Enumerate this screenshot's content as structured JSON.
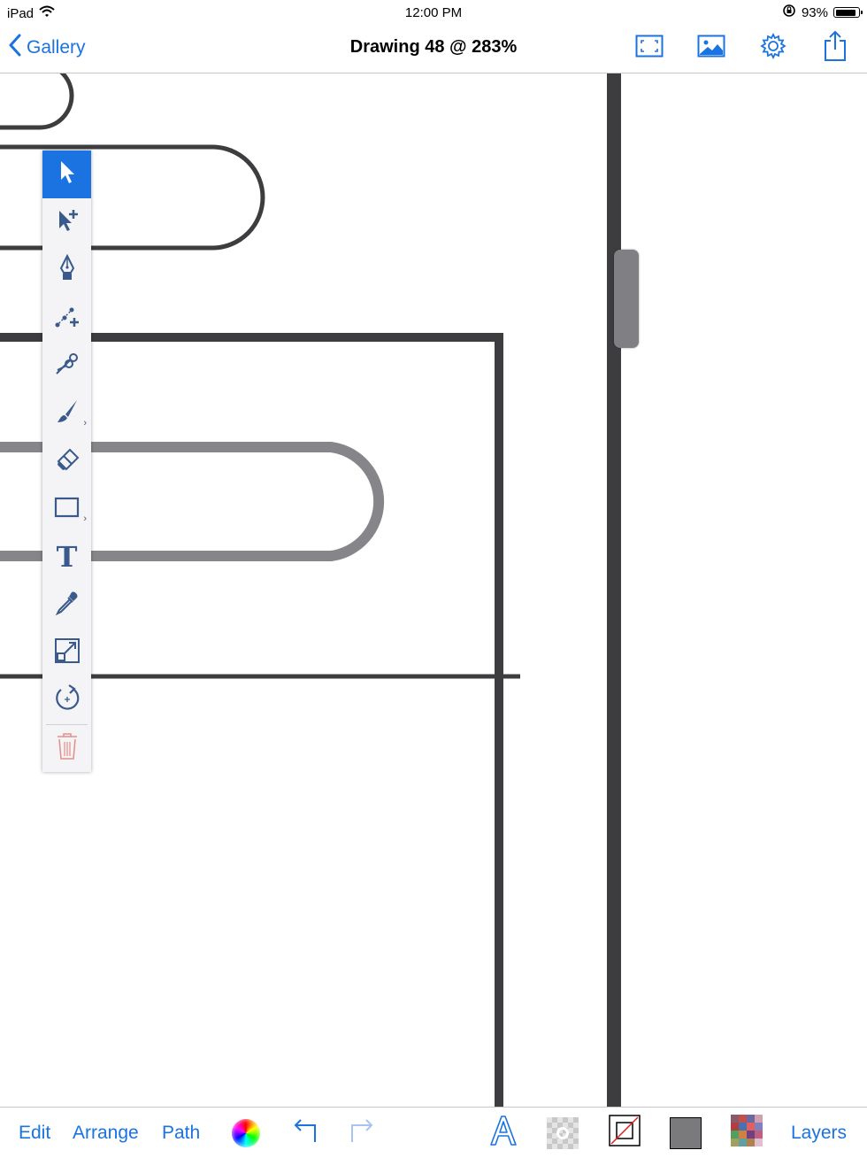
{
  "status_bar": {
    "device": "iPad",
    "time": "12:00 PM",
    "battery": "93%",
    "battery_level": 0.93
  },
  "nav": {
    "back_label": "Gallery",
    "title": "Drawing 48 @ 283%",
    "actions": [
      "fit-screen-icon",
      "image-icon",
      "gear-icon",
      "share-icon"
    ]
  },
  "tools": [
    {
      "name": "select",
      "icon": "arrow-cursor-icon",
      "active": true
    },
    {
      "name": "node-select",
      "icon": "arrow-plus-icon"
    },
    {
      "name": "pen",
      "icon": "pen-nib-icon"
    },
    {
      "name": "add-anchor",
      "icon": "anchor-plus-icon"
    },
    {
      "name": "scissors",
      "icon": "scissors-icon"
    },
    {
      "name": "brush",
      "icon": "brush-icon",
      "has_options": true
    },
    {
      "name": "eraser",
      "icon": "eraser-icon"
    },
    {
      "name": "shape",
      "icon": "rectangle-icon",
      "has_options": true
    },
    {
      "name": "text",
      "icon": "text-icon",
      "glyph": "T"
    },
    {
      "name": "eyedropper",
      "icon": "eyedropper-icon"
    },
    {
      "name": "scale",
      "icon": "scale-icon"
    },
    {
      "name": "rotate",
      "icon": "rotate-icon"
    },
    {
      "name": "delete",
      "icon": "trash-icon"
    }
  ],
  "bottom_bar": {
    "edit": "Edit",
    "arrange": "Arrange",
    "path": "Path",
    "layers": "Layers",
    "text_glyph": "A",
    "fill_color": "#7a7a7c"
  },
  "colors": {
    "accent": "#1a73e0",
    "stroke_dark": "#3d3d40",
    "stroke_gray": "#86868a",
    "scroll_thumb": "#808084",
    "delete_red": "#e58c8c"
  }
}
